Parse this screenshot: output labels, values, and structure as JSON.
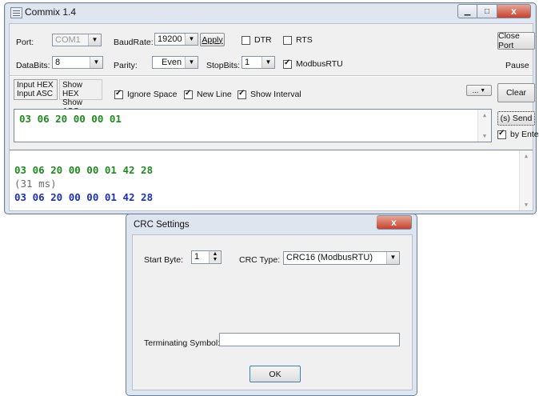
{
  "main_window": {
    "title": "Commix 1.4",
    "caption": {
      "close": "x"
    },
    "row1": {
      "port_label": "Port:",
      "port_value": "COM1",
      "baud_label": "BaudRate:",
      "baud_value": "19200",
      "apply_label": "Apply",
      "dtr_label": "DTR",
      "dtr_checked": false,
      "rts_label": "RTS",
      "rts_checked": false,
      "close_port_label": "Close Port"
    },
    "row2": {
      "databits_label": "DataBits:",
      "databits_value": "8",
      "parity_label": "Parity:",
      "parity_value": "Even",
      "stopbits_label": "StopBits:",
      "stopbits_value": "1",
      "modbus_label": "ModbusRTU",
      "modbus_checked": true,
      "pause_label": "Pause"
    },
    "options": {
      "input_hex": "Input HEX",
      "input_asc": "Input ASC",
      "show_hex": "Show HEX",
      "show_asc": "Show ASC",
      "ignore_space": "Ignore Space",
      "ignore_space_checked": true,
      "new_line": "New Line",
      "new_line_checked": true,
      "show_interval": "Show Interval",
      "show_interval_checked": true,
      "more_label": "...",
      "clear_label": "Clear"
    },
    "input": {
      "text": "03 06 20 00 00 01",
      "send_label": "(s) Send",
      "by_enter_label": "by Enter",
      "by_enter_checked": true
    },
    "output": {
      "line1": "03 06 20 00 00 01 42 28",
      "line2": "(31 ms)",
      "line3": "03 06 20 00 00 01 42 28",
      "color_sent": "#1f8a1f",
      "color_interval": "#6d6d6d",
      "color_received": "#1a2fbf"
    }
  },
  "crc_dialog": {
    "title": "CRC Settings",
    "close": "x",
    "start_byte_label": "Start Byte:",
    "start_byte_value": "1",
    "crc_type_label": "CRC Type:",
    "crc_type_value": "CRC16 (ModbusRTU)",
    "terminating_label": "Terminating Symbol:",
    "terminating_value": "",
    "ok_label": "OK"
  }
}
